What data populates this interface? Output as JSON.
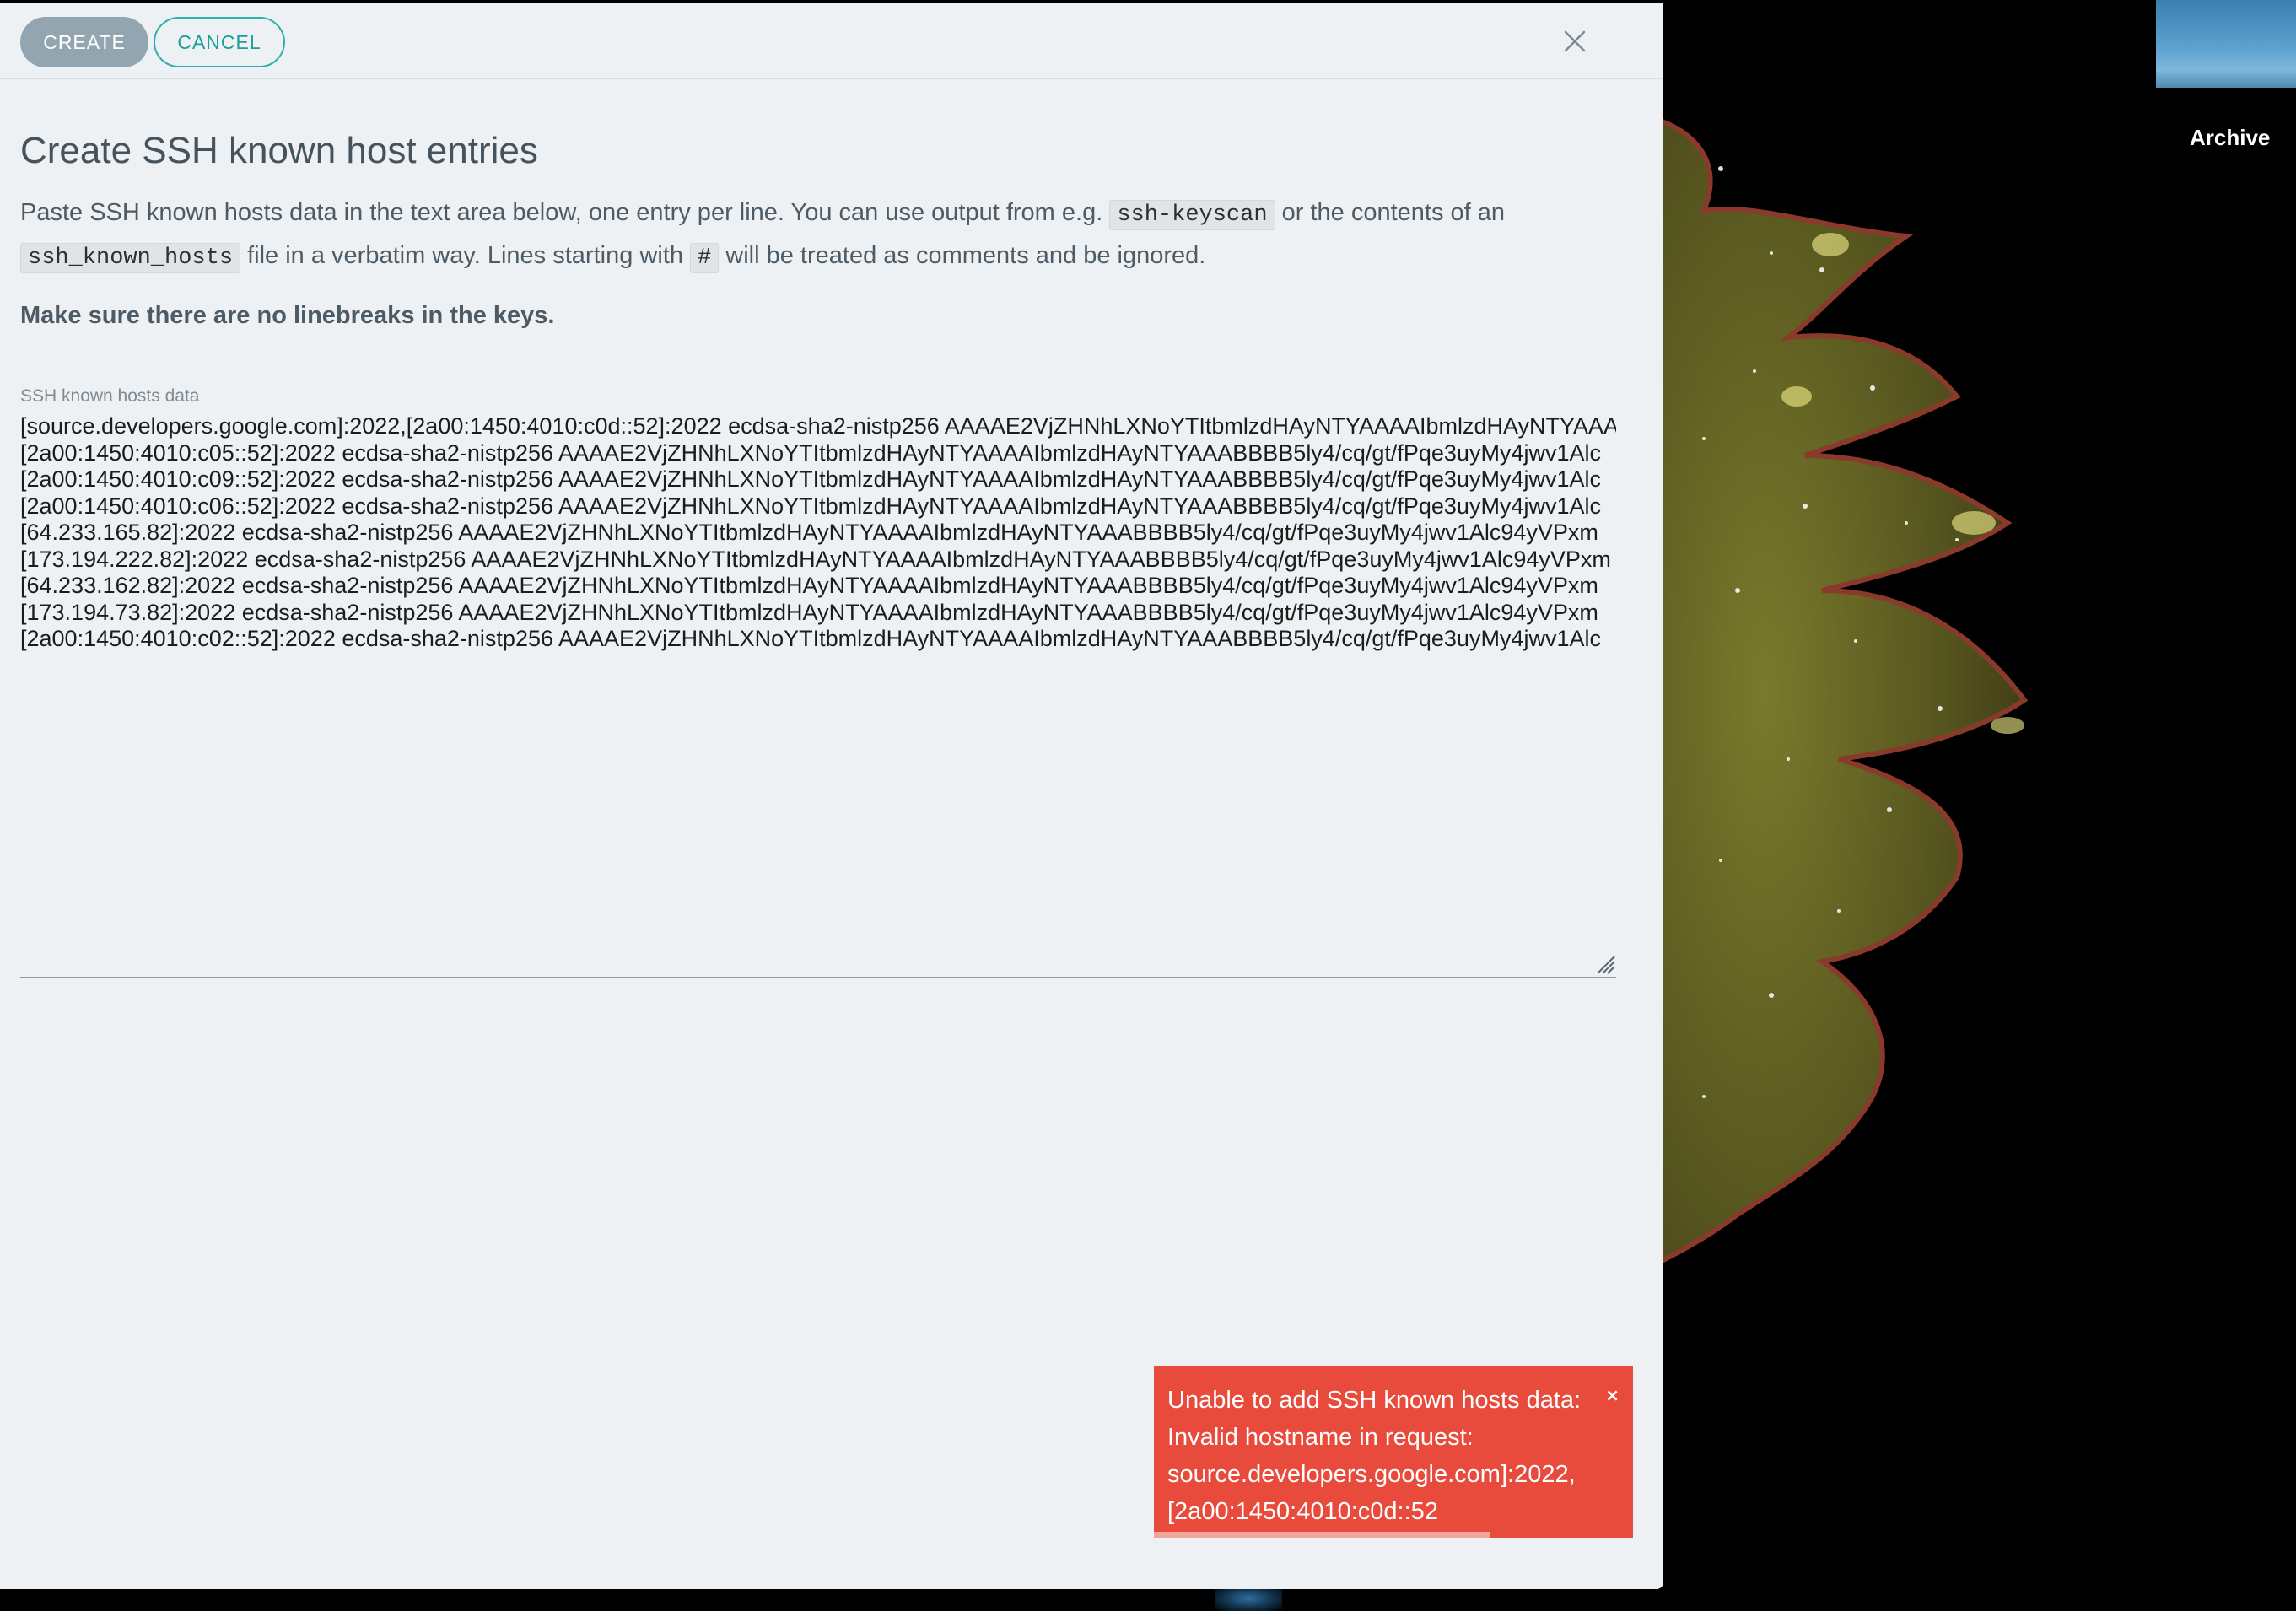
{
  "toolbar": {
    "create_label": "CREATE",
    "cancel_label": "CANCEL",
    "close_icon": "close-icon"
  },
  "dialog": {
    "title": "Create SSH known host entries",
    "desc_part1": "Paste SSH known hosts data in the text area below, one entry per line. You can use output from e.g. ",
    "code_keyscan": "ssh-keyscan",
    "desc_part2": " or the contents of an ",
    "code_known_hosts": "ssh_known_hosts",
    "desc_part3": " file in a verbatim way. Lines starting with ",
    "code_hash": "#",
    "desc_part4": " will be treated as comments and be ignored.",
    "warning": "Make sure there are no linebreaks in the keys."
  },
  "field": {
    "label": "SSH known hosts data",
    "lines": [
      "[source.developers.google.com]:2022,[2a00:1450:4010:c0d::52]:2022 ecdsa-sha2-nistp256 AAAAE2VjZHNhLXNoYTItbmlzdHAyNTYAAAAIbmlzdHAyNTYAAA",
      "[2a00:1450:4010:c05::52]:2022 ecdsa-sha2-nistp256 AAAAE2VjZHNhLXNoYTItbmlzdHAyNTYAAAAIbmlzdHAyNTYAAABBBB5ly4/cq/gt/fPqe3uyMy4jwv1Alc",
      "[2a00:1450:4010:c09::52]:2022 ecdsa-sha2-nistp256 AAAAE2VjZHNhLXNoYTItbmlzdHAyNTYAAAAIbmlzdHAyNTYAAABBBB5ly4/cq/gt/fPqe3uyMy4jwv1Alc",
      "[2a00:1450:4010:c06::52]:2022 ecdsa-sha2-nistp256 AAAAE2VjZHNhLXNoYTItbmlzdHAyNTYAAAAIbmlzdHAyNTYAAABBBB5ly4/cq/gt/fPqe3uyMy4jwv1Alc",
      "[64.233.165.82]:2022 ecdsa-sha2-nistp256 AAAAE2VjZHNhLXNoYTItbmlzdHAyNTYAAAAIbmlzdHAyNTYAAABBBB5ly4/cq/gt/fPqe3uyMy4jwv1Alc94yVPxm",
      "[173.194.222.82]:2022 ecdsa-sha2-nistp256 AAAAE2VjZHNhLXNoYTItbmlzdHAyNTYAAAAIbmlzdHAyNTYAAABBBB5ly4/cq/gt/fPqe3uyMy4jwv1Alc94yVPxm",
      "[64.233.162.82]:2022 ecdsa-sha2-nistp256 AAAAE2VjZHNhLXNoYTItbmlzdHAyNTYAAAAIbmlzdHAyNTYAAABBBB5ly4/cq/gt/fPqe3uyMy4jwv1Alc94yVPxm",
      "[173.194.73.82]:2022 ecdsa-sha2-nistp256 AAAAE2VjZHNhLXNoYTItbmlzdHAyNTYAAAAIbmlzdHAyNTYAAABBBB5ly4/cq/gt/fPqe3uyMy4jwv1Alc94yVPxm",
      "[2a00:1450:4010:c02::52]:2022 ecdsa-sha2-nistp256 AAAAE2VjZHNhLXNoYTItbmlzdHAyNTYAAAAIbmlzdHAyNTYAAABBBB5ly4/cq/gt/fPqe3uyMy4jwv1Alc"
    ]
  },
  "toast": {
    "lines": [
      "Unable to add SSH known hosts data:",
      "Invalid hostname in request:",
      "source.developers.google.com]:2022,",
      "[2a00:1450:4010:c0d::52"
    ],
    "close_glyph": "×",
    "progress": 0.7
  },
  "background": {
    "archive_label": "Archive"
  },
  "colors": {
    "modal_bg": "#eef1f3",
    "create_button": "#94a5b2",
    "cancel_accent": "#1a9e98",
    "toast_bg": "#e84b3c",
    "text": "#4d5b66"
  }
}
